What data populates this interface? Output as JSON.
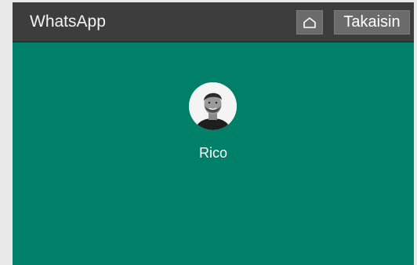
{
  "window": {
    "title": "WhatsApp",
    "home_icon": "home-icon",
    "back_label": "Takaisin"
  },
  "contact": {
    "name": "Rico",
    "avatar_icon": "contact-photo"
  },
  "colors": {
    "titlebar": "#3d3d3d",
    "main_background": "#008069",
    "button_background": "#6b6b6b"
  }
}
